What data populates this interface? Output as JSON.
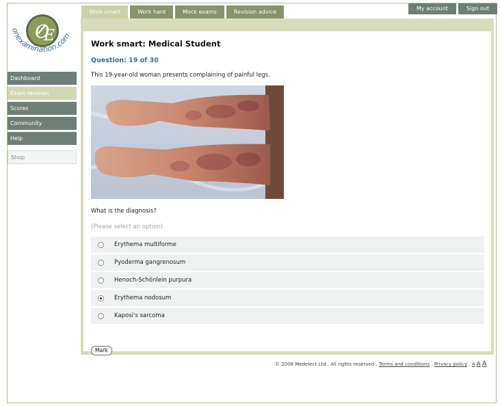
{
  "logo": {
    "letters": "OE",
    "brand": "onexamination.com"
  },
  "tabs": [
    {
      "label": "Work smart",
      "active": true
    },
    {
      "label": "Work hard",
      "active": false
    },
    {
      "label": "Mock exams",
      "active": false
    },
    {
      "label": "Revision advice",
      "active": false
    }
  ],
  "account": {
    "my_account": "My account",
    "sign_out": "Sign out"
  },
  "sidebar": {
    "items": [
      {
        "label": "Dashboard"
      },
      {
        "label": "Exam revision"
      },
      {
        "label": "Scores"
      },
      {
        "label": "Community"
      },
      {
        "label": "Help"
      }
    ],
    "shop": "Shop"
  },
  "main": {
    "title": "Work smart: Medical Student",
    "question_number": "Question: 19 of 30",
    "stem": "This 19-year-old woman presents complaining of painful legs.",
    "question": "What is the diagnosis?",
    "hint": "(Please select an option)",
    "options": [
      {
        "label": "Erythema multiforme",
        "selected": false
      },
      {
        "label": "Pyoderma gangrenosum",
        "selected": false
      },
      {
        "label": "Henoch-Schönlein purpura",
        "selected": false
      },
      {
        "label": "Erythema nodosum",
        "selected": true
      },
      {
        "label": "Kaposi's sarcoma",
        "selected": false
      }
    ],
    "mark_button": "Mark"
  },
  "footer": {
    "copyright": "© 2008 Medelect Ltd . All rights reserved .",
    "terms": "Terms and conditions",
    "sep": ".",
    "privacy": "Privacy policy",
    "font_sizes": [
      "A",
      "A",
      "A"
    ]
  },
  "colors": {
    "nav": "#6f7e76",
    "tab": "#87936a",
    "active": "#ccd2a7",
    "panel": "#d9dcbc",
    "accent": "#3a6c8f"
  }
}
